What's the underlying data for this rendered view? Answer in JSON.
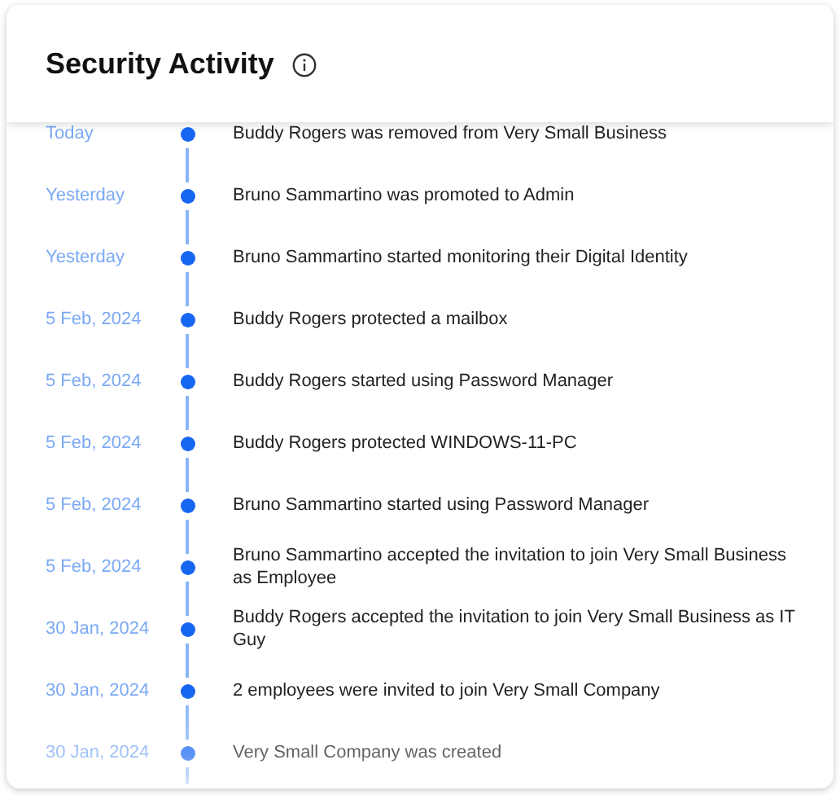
{
  "card": {
    "title": "Security Activity"
  },
  "events": [
    {
      "date": "Today",
      "text": "Buddy Rogers was removed from Very Small Business"
    },
    {
      "date": "Yesterday",
      "text": "Bruno Sammartino was promoted to Admin"
    },
    {
      "date": "Yesterday",
      "text": "Bruno Sammartino started monitoring their Digital Identity"
    },
    {
      "date": "5 Feb, 2024",
      "text": "Buddy Rogers protected a mailbox"
    },
    {
      "date": "5 Feb, 2024",
      "text": "Buddy Rogers started using Password Manager"
    },
    {
      "date": "5 Feb, 2024",
      "text": "Buddy Rogers protected WINDOWS-11-PC"
    },
    {
      "date": "5 Feb, 2024",
      "text": "Bruno Sammartino started using Password Manager"
    },
    {
      "date": "5 Feb, 2024",
      "text": "Bruno Sammartino accepted the invitation to join Very Small Business as Employee"
    },
    {
      "date": "30 Jan, 2024",
      "text": "Buddy Rogers accepted the invitation to join Very Small Business as IT Guy"
    },
    {
      "date": "30 Jan, 2024",
      "text": "2 employees were invited to join Very Small Company"
    },
    {
      "date": "30 Jan, 2024",
      "text": "Very Small Company was created"
    }
  ]
}
